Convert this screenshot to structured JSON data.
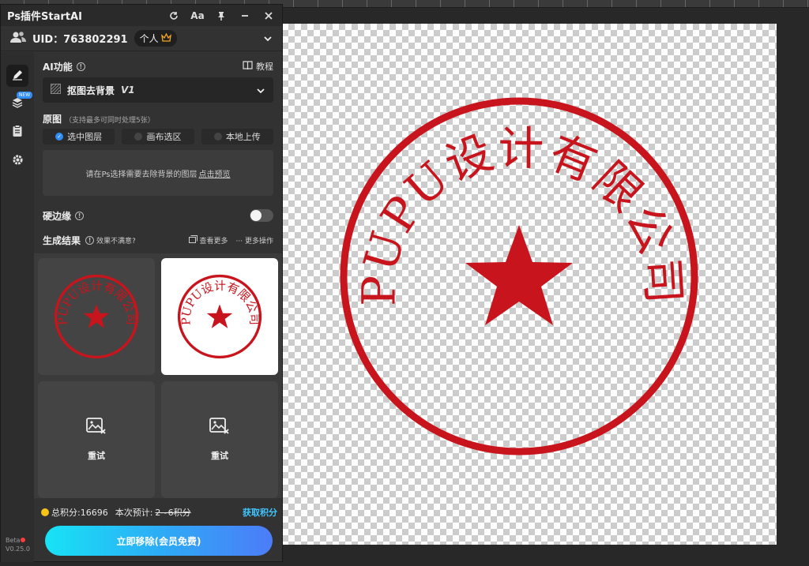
{
  "panel": {
    "title": "Ps插件StartAI",
    "title_icons": [
      "refresh-icon",
      "font-icon",
      "pin-icon",
      "minimize-icon",
      "close-icon"
    ],
    "font_icon_text": "Aa"
  },
  "user": {
    "uid_label": "UID：763802291",
    "plan": "个人"
  },
  "sidebar": {
    "new_badge": "NEW",
    "beta": "Beta",
    "version": "V0.25.0"
  },
  "ai_function": {
    "title": "AI功能",
    "tutorial_label": "教程",
    "selected_tool": "抠图去背景",
    "selected_version": "V1"
  },
  "source": {
    "title": "原图",
    "note": "（支持最多可同时处理5张）",
    "options": [
      "选中图层",
      "画布选区",
      "本地上传"
    ],
    "selected_index": 0,
    "hint_text": "请在Ps选择需要去除背景的图层",
    "hint_link": "点击预览"
  },
  "hard_edge": {
    "label": "硬边缘",
    "enabled": false
  },
  "results": {
    "title": "生成结果",
    "dissatisfied": "效果不满意?",
    "view_more": "查看更多",
    "more_actions": "··· 更多操作",
    "retry_label": "重试"
  },
  "stamp": {
    "text": "PUPU设计有限公司",
    "color": "#c8141c"
  },
  "footer": {
    "points": "总积分:16696",
    "estimate_label": "本次预计:",
    "estimate_value": "2~6积分",
    "get_points": "获取积分",
    "remove_button": "立即移除(会员免费)"
  },
  "colors": {
    "accent_blue": "#2f8df5",
    "cta_gradient_start": "#17e3f5",
    "cta_gradient_end": "#4c7cf8",
    "coin": "#f5c518",
    "get_points": "#3ec6ff"
  }
}
